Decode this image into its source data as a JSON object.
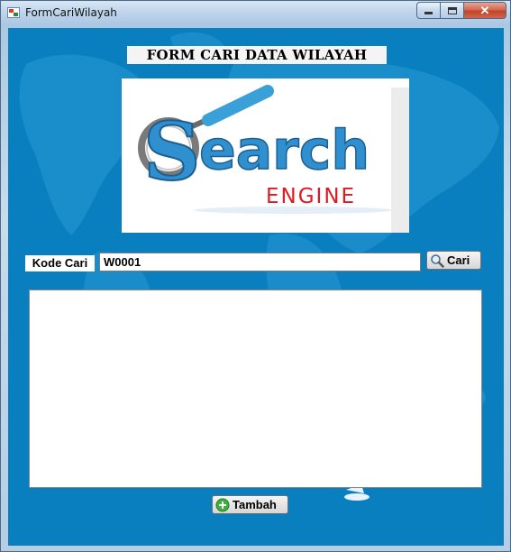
{
  "window": {
    "title": "FormCariWilayah",
    "close_glyph": "✕"
  },
  "form": {
    "heading": "FORM CARI DATA WILAYAH",
    "logo": {
      "main_text": "Search",
      "sub_text": "ENGINE"
    },
    "search": {
      "label": "Kode Cari",
      "value": "W0001",
      "button_label": "Cari",
      "button_icon": "magnifier-icon"
    },
    "results": {
      "rows": []
    },
    "add_button": {
      "label": "Tambah",
      "icon": "plus-circle-icon"
    }
  },
  "colors": {
    "client_background": "#0a7fc0",
    "logo_blue": "#2f8fcf",
    "logo_red": "#e0181f"
  }
}
